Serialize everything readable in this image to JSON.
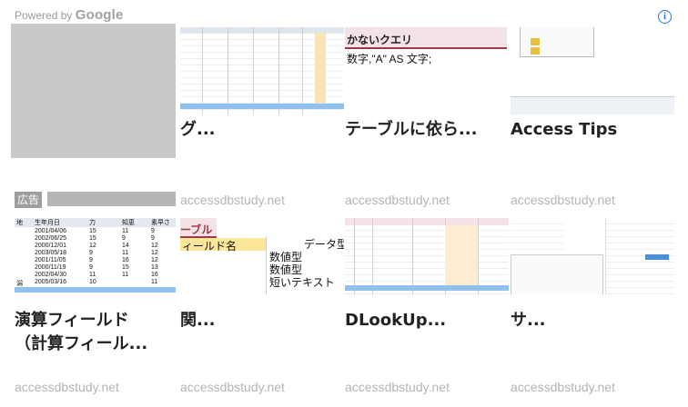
{
  "header": {
    "powered_prefix": "Powered by",
    "powered_brand": "Google",
    "info_icon": "i"
  },
  "ad": {
    "badge": "広告"
  },
  "cards": [
    {
      "title": "グ...",
      "source": "accessdbstudy.net"
    },
    {
      "title": "テーブルに依ら...",
      "source": "accessdbstudy.net",
      "thumb_text": "かないクエリ",
      "thumb_code": "数字,\"A\" AS 文字;"
    },
    {
      "title": "Access Tips",
      "source": "accessdbstudy.net"
    },
    {
      "title": "演算フィールド\n（計算フィール...",
      "source": "accessdbstudy.net",
      "thumb_headers": [
        "地",
        "生年月日",
        "力",
        "知恵",
        "素早さ"
      ],
      "thumb_rows": [
        [
          "",
          "2001/04/06",
          "15",
          "11",
          "9"
        ],
        [
          "",
          "2002/06/25",
          "15",
          "9",
          "9"
        ],
        [
          "",
          "2000/12/01",
          "12",
          "14",
          "12"
        ],
        [
          "",
          "2003/05/18",
          "9",
          "11",
          "12"
        ],
        [
          "",
          "2001/11/05",
          "9",
          "16",
          "12"
        ],
        [
          "",
          "2000/11/19",
          "9",
          "15",
          "13"
        ],
        [
          "",
          "2002/04/30",
          "11",
          "11",
          "16"
        ],
        [
          "潟",
          "2005/03/16",
          "10",
          "",
          "11"
        ]
      ]
    },
    {
      "title": "関...",
      "source": "accessdbstudy.net",
      "thumb_tab": "ーブル",
      "thumb_col1": "ィールド名",
      "thumb_col2": "データ型",
      "thumb_types": [
        "数値型",
        "数値型",
        "短いテキスト"
      ]
    },
    {
      "title": "DLookUp...",
      "source": "accessdbstudy.net"
    },
    {
      "title": "サ...",
      "source": "accessdbstudy.net"
    }
  ]
}
